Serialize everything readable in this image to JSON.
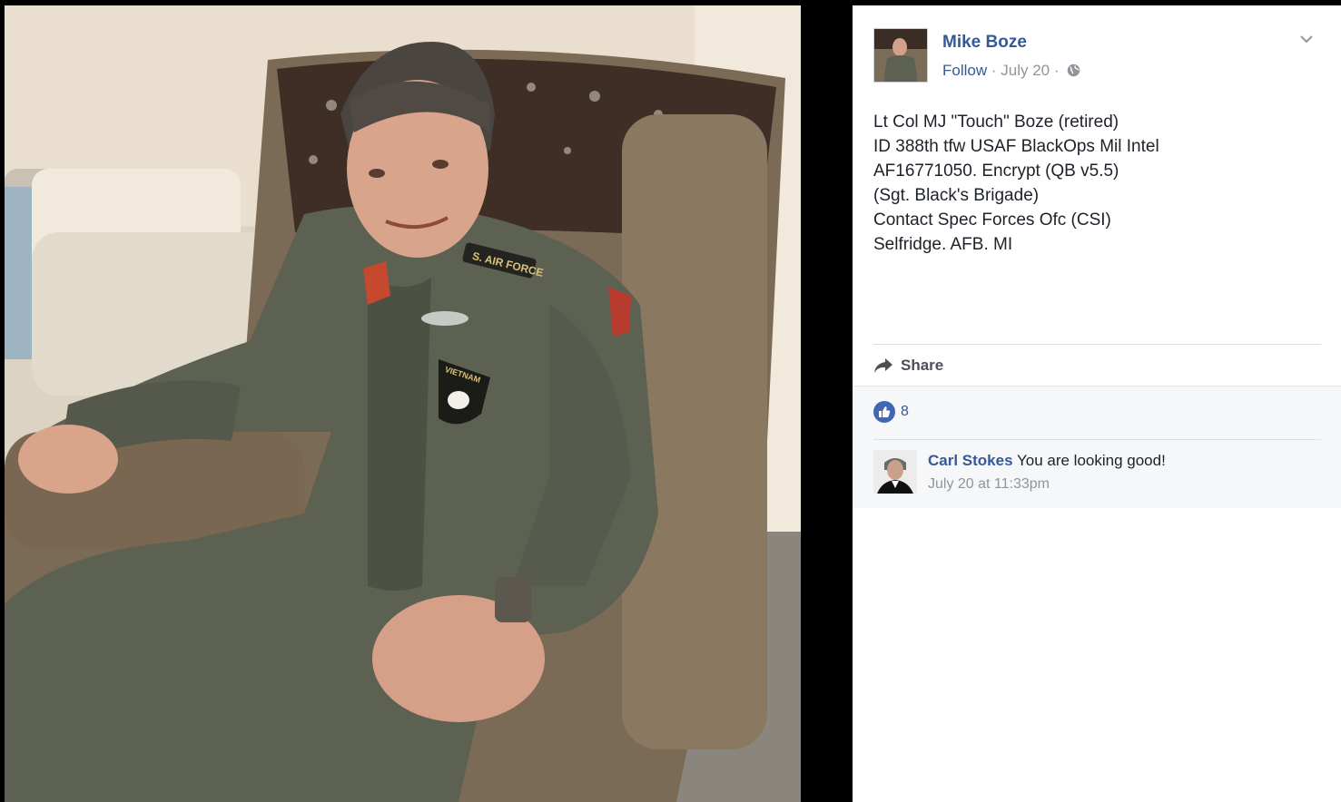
{
  "post": {
    "author": "Mike Boze",
    "follow": "Follow",
    "separator_1": " · ",
    "date": "July 20",
    "separator_2": " · ",
    "privacy_icon": "globe-icon",
    "menu_icon": "chevron-down-icon",
    "text_lines": [
      "Lt Col MJ \"Touch\" Boze (retired)",
      "ID 388th tfw USAF BlackOps Mil Intel",
      "AF16771050. Encrypt (QB v5.5)",
      "(Sgt. Black's Brigade)",
      "Contact Spec Forces Ofc (CSI)",
      "Selfridge. AFB. MI"
    ]
  },
  "actions": {
    "share_label": "Share",
    "share_icon": "share-arrow-icon"
  },
  "reactions": {
    "like_icon": "thumbs-up-icon",
    "count": "8"
  },
  "comments": [
    {
      "author": "Carl Stokes",
      "text": "You are looking good!",
      "time": "July 20 at 11:33pm"
    }
  ],
  "photo": {
    "patch_tab": "S. AIR FORCE",
    "patch_vietnam": "VIETNAM"
  },
  "colors": {
    "link": "#365899",
    "muted": "#90949c",
    "like_blue": "#4267b2",
    "backdrop": "#000000"
  }
}
